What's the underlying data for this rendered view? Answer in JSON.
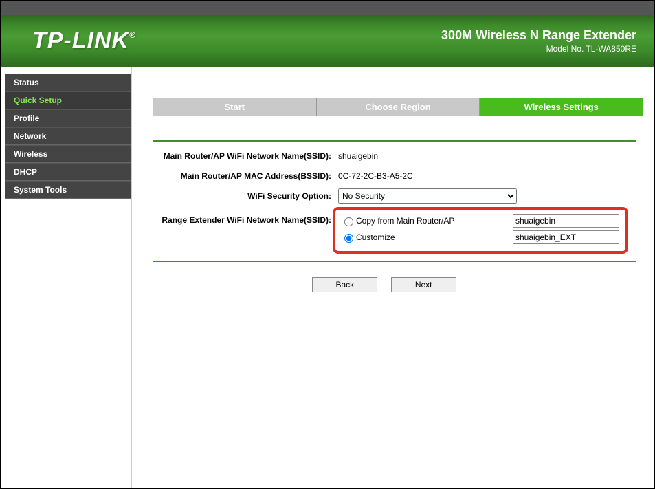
{
  "header": {
    "logo": "TP-LINK",
    "logo_mark": "®",
    "product_title": "300M Wireless N Range Extender",
    "model_label": "Model No. TL-WA850RE"
  },
  "sidebar": {
    "items": [
      {
        "label": "Status",
        "active": false
      },
      {
        "label": "Quick Setup",
        "active": true
      },
      {
        "label": "Profile",
        "active": false
      },
      {
        "label": "Network",
        "active": false
      },
      {
        "label": "Wireless",
        "active": false
      },
      {
        "label": "DHCP",
        "active": false
      },
      {
        "label": "System Tools",
        "active": false
      }
    ]
  },
  "steps": [
    {
      "label": "Start",
      "active": false
    },
    {
      "label": "Choose Region",
      "active": false
    },
    {
      "label": "Wireless Settings",
      "active": true
    }
  ],
  "form": {
    "ssid_label": "Main Router/AP WiFi Network Name(SSID):",
    "ssid_value": "shuaigebin",
    "bssid_label": "Main Router/AP MAC Address(BSSID):",
    "bssid_value": "0C-72-2C-B3-A5-2C",
    "security_label": "WiFi Security Option:",
    "security_value": "No Security",
    "ext_ssid_label": "Range Extender WiFi Network Name(SSID):",
    "opt_copy_label": "Copy from Main Router/AP",
    "opt_copy_value": "shuaigebin",
    "opt_custom_label": "Customize",
    "opt_custom_value": "shuaigebin_EXT"
  },
  "buttons": {
    "back": "Back",
    "next": "Next"
  }
}
